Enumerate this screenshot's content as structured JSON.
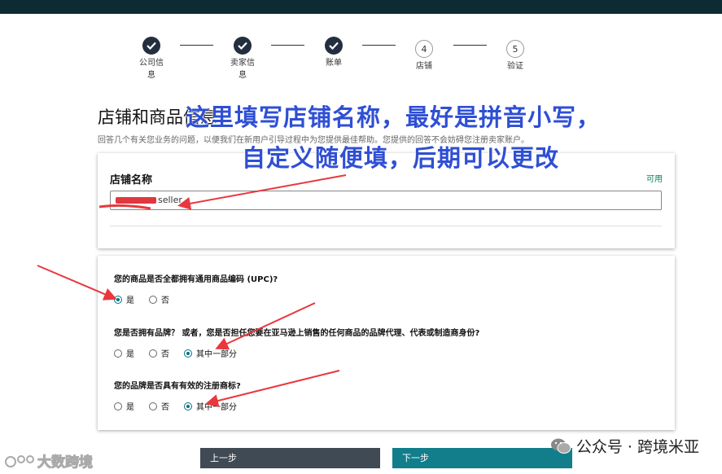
{
  "steps": [
    {
      "label": "公司信息",
      "state": "done"
    },
    {
      "label": "卖家信息",
      "state": "done"
    },
    {
      "label": "账单",
      "state": "done"
    },
    {
      "label": "店铺",
      "state": "todo",
      "number": "4"
    },
    {
      "label": "验证",
      "state": "todo",
      "number": "5"
    }
  ],
  "page": {
    "title": "店铺和商品信息",
    "description": "回答几个有关您业务的问题，以便我们在新用户引导过程中为您提供最佳帮助。您提供的回答不会妨碍您注册卖家账户。"
  },
  "store": {
    "label": "店铺名称",
    "availability": "可用",
    "value": "seller"
  },
  "questions": [
    {
      "text": "您的商品是否全都拥有通用商品编码 (UPC)?",
      "options": [
        "是",
        "否"
      ],
      "selected": 0
    },
    {
      "text": "您是否拥有品牌？ 或者，您是否担任您要在亚马逊上销售的任何商品的品牌代理、代表或制造商身份?",
      "options": [
        "是",
        "否",
        "其中一部分"
      ],
      "selected": 2
    },
    {
      "text": "您的品牌是否具有有效的注册商标?",
      "options": [
        "是",
        "否",
        "其中一部分"
      ],
      "selected": 2
    }
  ],
  "buttons": {
    "prev": "上一步",
    "next": "下一步"
  },
  "annotation": {
    "line1": "这里填写店铺名称，最好是拼音小写，",
    "line2": "自定义随便填，后期可以更改",
    "color": "#2f4fd4",
    "arrow_color": "#e8383d"
  },
  "watermarks": {
    "left": "大数跨境",
    "right": "公众号 · 跨境米亚"
  }
}
